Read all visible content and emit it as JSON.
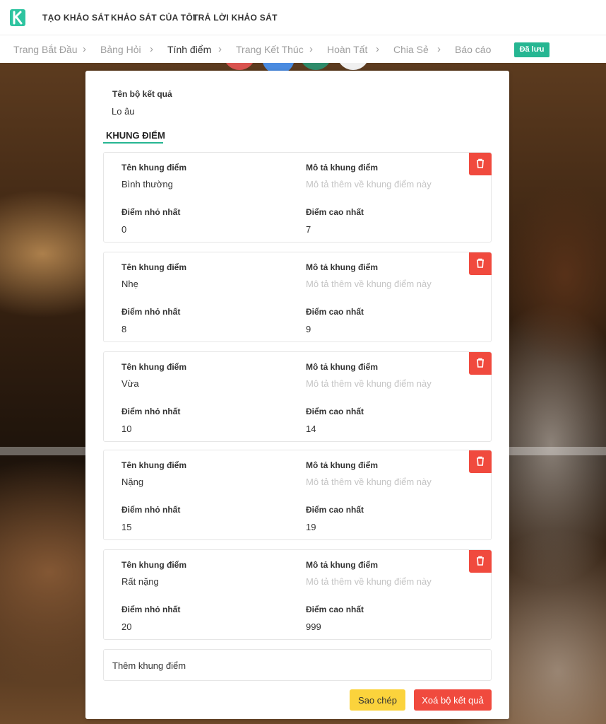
{
  "nav": {
    "items": [
      "TẠO KHẢO SÁT",
      "KHẢO SÁT CỦA TÔI",
      "TRẢ LỜI KHẢO SÁT"
    ]
  },
  "steps": {
    "items": [
      "Trang Bắt Đầu",
      "Bảng Hỏi",
      "Tính điểm",
      "Trang Kết Thúc",
      "Hoàn Tất",
      "Chia Sẻ",
      "Báo cáo"
    ],
    "active": "Tính điểm",
    "saved_badge": "Đã lưu"
  },
  "result_set": {
    "name_label": "Tên bộ kết quả",
    "name_value": "Lo âu"
  },
  "section_title": "KHUNG ĐIỂM",
  "labels": {
    "range_name": "Tên khung điểm",
    "range_desc": "Mô tả khung điểm",
    "min": "Điểm nhỏ nhất",
    "max": "Điểm cao nhất",
    "desc_placeholder": "Mô tả thêm về khung điểm này"
  },
  "ranges": [
    {
      "name": "Bình thường",
      "min": "0",
      "max": "7"
    },
    {
      "name": "Nhẹ",
      "min": "8",
      "max": "9"
    },
    {
      "name": "Vừa",
      "min": "10",
      "max": "14"
    },
    {
      "name": "Nặng",
      "min": "15",
      "max": "19"
    },
    {
      "name": "Rất nặng",
      "min": "20",
      "max": "999"
    }
  ],
  "add_range": "Thêm khung điểm",
  "buttons": {
    "copy": "Sao chép",
    "delete_set": "Xoá bộ kết quả"
  },
  "colors": {
    "accent": "#26b692",
    "danger": "#f04a3e",
    "warning": "#fbd33c"
  }
}
